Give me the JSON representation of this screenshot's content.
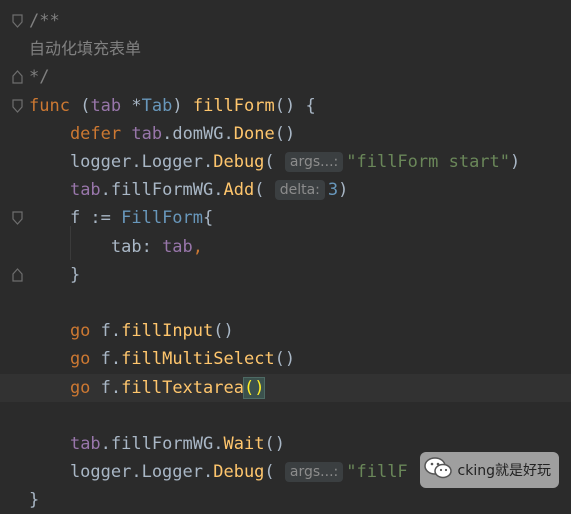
{
  "editor": {
    "lines": [
      {
        "segments": [
          {
            "t": "/**",
            "c": "cmt"
          }
        ]
      },
      {
        "segments": [
          {
            "t": "自动化填充表单",
            "c": "cmt-cn"
          }
        ]
      },
      {
        "segments": [
          {
            "t": "*/",
            "c": "cmt"
          }
        ]
      },
      {
        "segments": [
          {
            "t": "func",
            "c": "kw"
          },
          {
            "t": " (",
            "c": "pn"
          },
          {
            "t": "tab",
            "c": "fld"
          },
          {
            "t": " *",
            "c": "pn"
          },
          {
            "t": "Tab",
            "c": "type"
          },
          {
            "t": ") ",
            "c": "pn"
          },
          {
            "t": "fillForm",
            "c": "fn"
          },
          {
            "t": "() {",
            "c": "pn"
          }
        ]
      },
      {
        "segments": [
          {
            "t": "    defer",
            "c": "kw"
          },
          {
            "t": " ",
            "c": "pn"
          },
          {
            "t": "tab",
            "c": "fld"
          },
          {
            "t": ".domWG.",
            "c": "pn"
          },
          {
            "t": "Done",
            "c": "fn"
          },
          {
            "t": "()",
            "c": "pn"
          }
        ]
      },
      {
        "segments": [
          {
            "t": "    logger.Logger.",
            "c": "pn"
          },
          {
            "t": "Debug",
            "c": "fn"
          },
          {
            "t": "( ",
            "c": "pn"
          },
          {
            "t": "args...:",
            "c": "hint"
          },
          {
            "t": "\"fillForm start\"",
            "c": "str"
          },
          {
            "t": ")",
            "c": "pn"
          }
        ]
      },
      {
        "segments": [
          {
            "t": "    ",
            "c": "pn"
          },
          {
            "t": "tab",
            "c": "fld"
          },
          {
            "t": ".fillFormWG.",
            "c": "pn"
          },
          {
            "t": "Add",
            "c": "fn"
          },
          {
            "t": "( ",
            "c": "pn"
          },
          {
            "t": "delta:",
            "c": "hint"
          },
          {
            "t": "3",
            "c": "num"
          },
          {
            "t": ")",
            "c": "pn"
          }
        ]
      },
      {
        "segments": [
          {
            "t": "    f := ",
            "c": "pn"
          },
          {
            "t": "FillForm",
            "c": "type"
          },
          {
            "t": "{",
            "c": "pn"
          }
        ]
      },
      {
        "segments": [
          {
            "t": "        tab: ",
            "c": "pn"
          },
          {
            "t": "tab",
            "c": "fld"
          },
          {
            "t": ",",
            "c": "kw"
          }
        ]
      },
      {
        "segments": [
          {
            "t": "    }",
            "c": "pn"
          }
        ]
      },
      {
        "segments": []
      },
      {
        "segments": [
          {
            "t": "    go",
            "c": "kw"
          },
          {
            "t": " f.",
            "c": "pn"
          },
          {
            "t": "fillInput",
            "c": "fn"
          },
          {
            "t": "()",
            "c": "pn"
          }
        ]
      },
      {
        "segments": [
          {
            "t": "    go",
            "c": "kw"
          },
          {
            "t": " f.",
            "c": "pn"
          },
          {
            "t": "fillMultiSelect",
            "c": "fn"
          },
          {
            "t": "()",
            "c": "pn"
          }
        ]
      },
      {
        "segments": [
          {
            "t": "    go",
            "c": "kw"
          },
          {
            "t": " f.",
            "c": "pn"
          },
          {
            "t": "fillTextarea",
            "c": "fn"
          },
          {
            "t": "()",
            "c": "brace-hl"
          }
        ]
      },
      {
        "segments": []
      },
      {
        "segments": [
          {
            "t": "    ",
            "c": "pn"
          },
          {
            "t": "tab",
            "c": "fld"
          },
          {
            "t": ".fillFormWG.",
            "c": "pn"
          },
          {
            "t": "Wait",
            "c": "fn"
          },
          {
            "t": "()",
            "c": "pn"
          }
        ]
      },
      {
        "segments": [
          {
            "t": "    logger.Logger.",
            "c": "pn"
          },
          {
            "t": "Debug",
            "c": "fn"
          },
          {
            "t": "( ",
            "c": "pn"
          },
          {
            "t": "args...:",
            "c": "hint"
          },
          {
            "t": "\"fillF",
            "c": "str"
          }
        ]
      },
      {
        "segments": [
          {
            "t": "}",
            "c": "pn"
          }
        ]
      }
    ]
  },
  "watermark": {
    "text": "cking就是好玩",
    "icon": "wechat-icon"
  },
  "colors": {
    "background": "#2b2b2b",
    "keyword": "#cc7832",
    "function": "#ffc66d",
    "field": "#9876aa",
    "type": "#6897bb",
    "string": "#6a8759",
    "comment": "#808080"
  }
}
